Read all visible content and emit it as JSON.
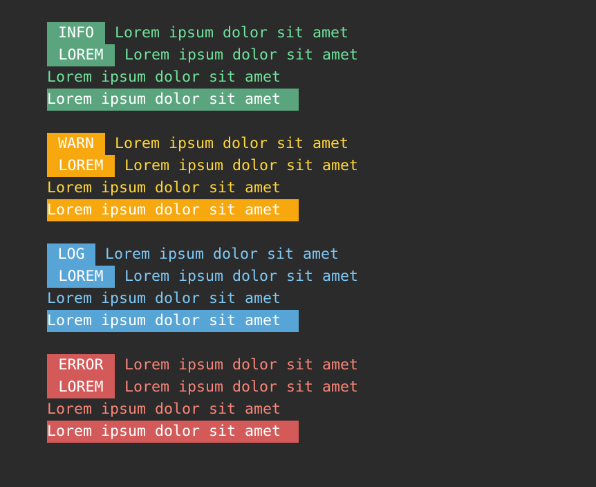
{
  "colors": {
    "background": "#2b2b2b",
    "info_bg": "#5aa57d",
    "info_text": "#6ee39a",
    "warn_bg": "#f6a80e",
    "warn_text": "#ffd63a",
    "log_bg": "#57a5d6",
    "log_text": "#7ec8f4",
    "error_bg": "#d45a5a",
    "error_text": "#f98477",
    "badge_text": "#ffffff"
  },
  "groups": [
    {
      "level": "info",
      "badge1": "INFO",
      "badge2": "LOREM",
      "line1": "Lorem ipsum dolor sit amet",
      "line2": "Lorem ipsum dolor sit amet",
      "line3": "Lorem ipsum dolor sit amet",
      "line4": "Lorem ipsum dolor sit amet"
    },
    {
      "level": "warn",
      "badge1": "WARN",
      "badge2": "LOREM",
      "line1": "Lorem ipsum dolor sit amet",
      "line2": "Lorem ipsum dolor sit amet",
      "line3": "Lorem ipsum dolor sit amet",
      "line4": "Lorem ipsum dolor sit amet"
    },
    {
      "level": "log",
      "badge1": "LOG",
      "badge2": "LOREM",
      "line1": "Lorem ipsum dolor sit amet",
      "line2": "Lorem ipsum dolor sit amet",
      "line3": "Lorem ipsum dolor sit amet",
      "line4": "Lorem ipsum dolor sit amet"
    },
    {
      "level": "error",
      "badge1": "ERROR",
      "badge2": "LOREM",
      "line1": "Lorem ipsum dolor sit amet",
      "line2": "Lorem ipsum dolor sit amet",
      "line3": "Lorem ipsum dolor sit amet",
      "line4": "Lorem ipsum dolor sit amet"
    }
  ]
}
